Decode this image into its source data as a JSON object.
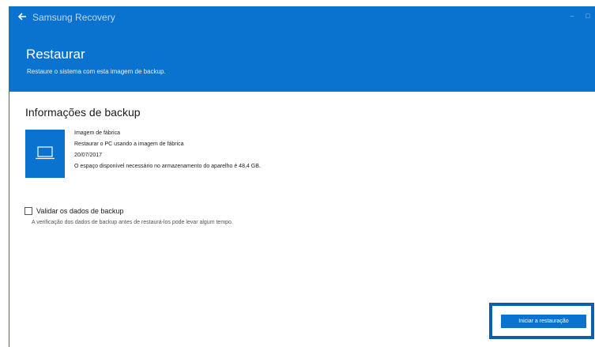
{
  "app": {
    "title": "Samsung Recovery",
    "minimize_glyph": "–",
    "maximize_glyph": "□"
  },
  "header": {
    "title": "Restaurar",
    "subtitle": "Restaure o sistema com esta imagem de backup."
  },
  "backup_info": {
    "section_title": "Informações de backup",
    "icon": "laptop-icon",
    "name": "Imagem de fábrica",
    "description": "Restaurar o PC usando a imagem de fábrica",
    "date": "20/07/2017",
    "space_note": "O espaço disponível necessário no armazenamento do aparelho é 48,4 GB."
  },
  "validate": {
    "label": "Validar os dados de backup",
    "hint": "A verificação dos dados de backup antes de restaurá-los pode levar algum tempo.",
    "checked": false
  },
  "actions": {
    "start_label": "Iniciar a restauração"
  },
  "colors": {
    "accent": "#0a72cf",
    "highlight": "#0c5fa8"
  }
}
